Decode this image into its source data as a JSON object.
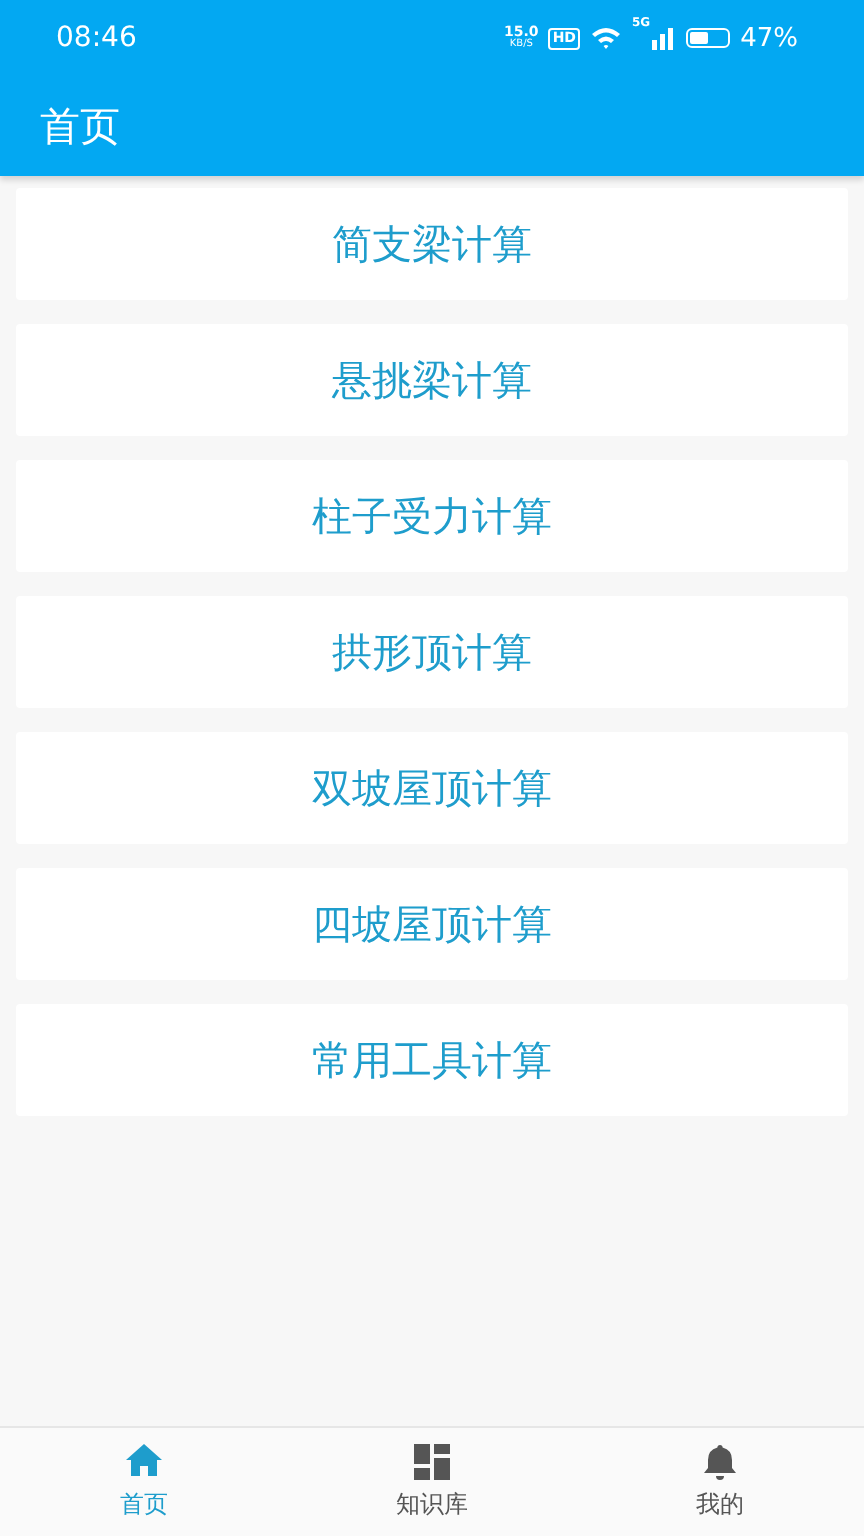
{
  "status_bar": {
    "time": "08:46",
    "net_speed": "15.0",
    "net_unit": "KB/S",
    "hd": "HD",
    "network": "5G",
    "battery": "47%"
  },
  "app_bar": {
    "title": "首页"
  },
  "items": [
    {
      "label": "简支梁计算"
    },
    {
      "label": "悬挑梁计算"
    },
    {
      "label": "柱子受力计算"
    },
    {
      "label": "拱形顶计算"
    },
    {
      "label": "双坡屋顶计算"
    },
    {
      "label": "四坡屋顶计算"
    },
    {
      "label": "常用工具计算"
    }
  ],
  "tabs": [
    {
      "label": "首页",
      "selected": true
    },
    {
      "label": "知识库",
      "selected": false
    },
    {
      "label": "我的",
      "selected": false
    }
  ]
}
